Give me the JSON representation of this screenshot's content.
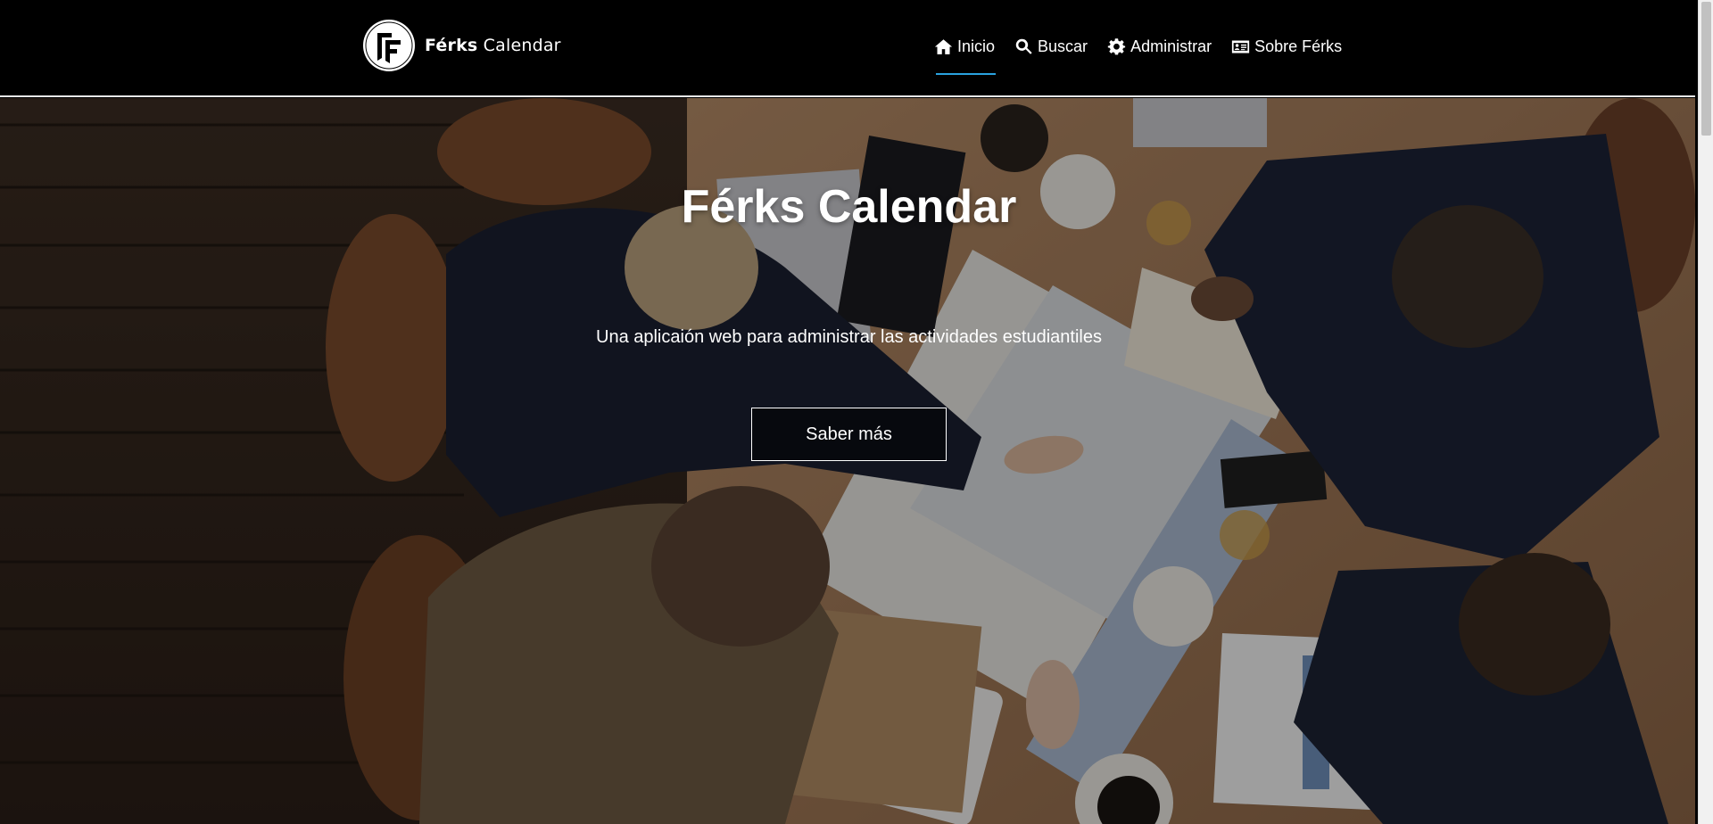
{
  "brand": {
    "name_bold": "Férks",
    "name_rest": " Calendar",
    "logo_icon": "ferks-logo"
  },
  "nav": {
    "items": [
      {
        "label": "Inicio",
        "icon": "home-icon",
        "active": true
      },
      {
        "label": "Buscar",
        "icon": "search-icon",
        "active": false
      },
      {
        "label": "Administrar",
        "icon": "gear-icon",
        "active": false
      },
      {
        "label": "Sobre Férks",
        "icon": "id-card-icon",
        "active": false
      }
    ],
    "active_underline_color": "#2aa3e0"
  },
  "hero": {
    "title": "Férks Calendar",
    "subtitle": "Una aplicaión web para administrar las actividades estudiantiles",
    "button_label": "Saber más"
  }
}
